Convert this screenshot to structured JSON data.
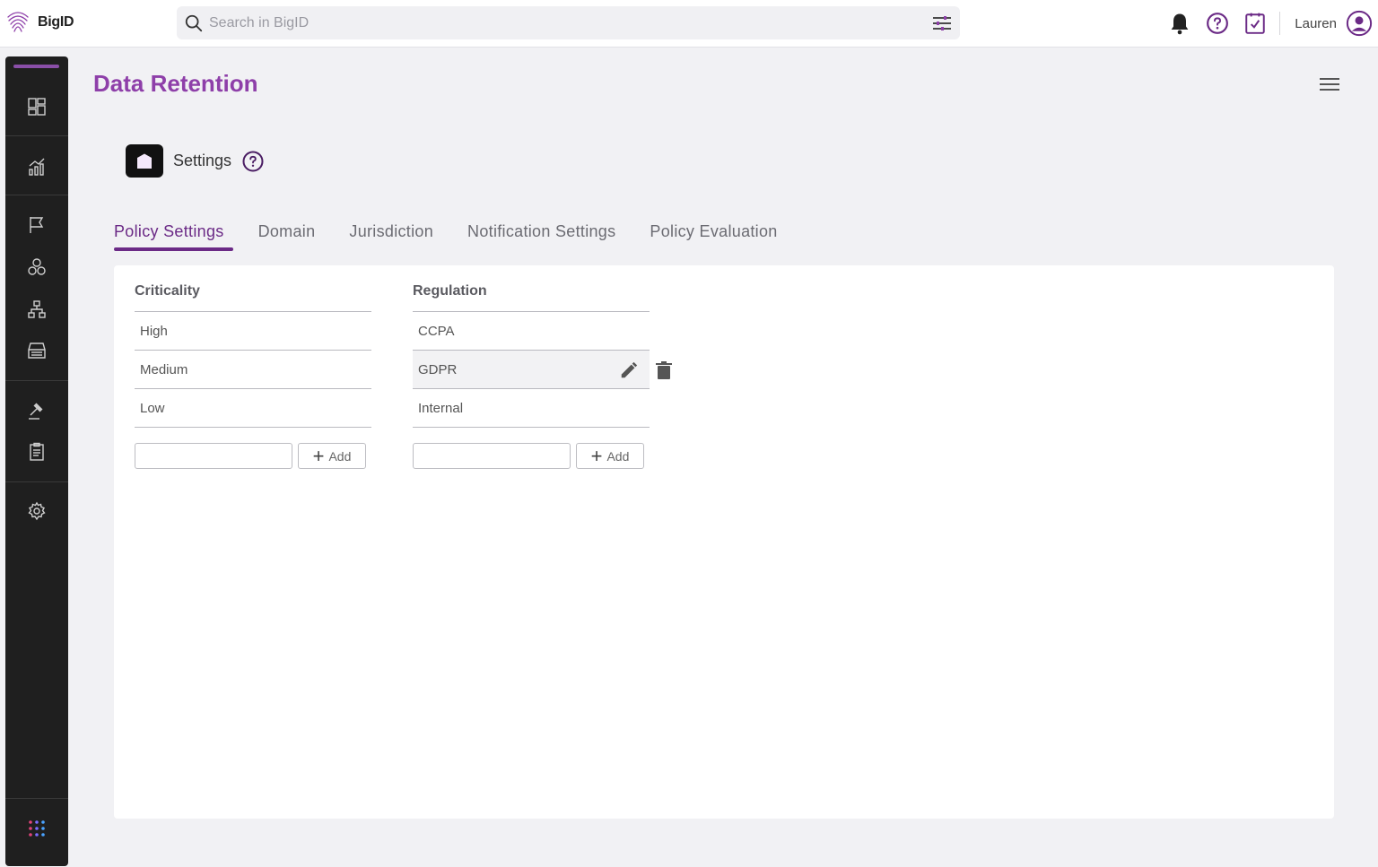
{
  "app": {
    "name": "BigID"
  },
  "search": {
    "placeholder": "Search in BigID"
  },
  "user": {
    "name": "Lauren"
  },
  "page": {
    "title": "Data Retention"
  },
  "settings": {
    "label": "Settings"
  },
  "tabs": [
    {
      "label": "Policy Settings",
      "active": true
    },
    {
      "label": "Domain"
    },
    {
      "label": "Jurisdiction"
    },
    {
      "label": "Notification Settings"
    },
    {
      "label": "Policy Evaluation"
    }
  ],
  "criticality": {
    "header": "Criticality",
    "items": [
      "High",
      "Medium",
      "Low"
    ],
    "add_label": "Add"
  },
  "regulation": {
    "header": "Regulation",
    "items": [
      "CCPA",
      "GDPR",
      "Internal"
    ],
    "add_label": "Add"
  },
  "sidebar": {
    "items": [
      "dashboard-icon",
      "analytics-icon",
      "flag-icon",
      "clusters-icon",
      "hierarchy-icon",
      "inventory-icon",
      "gavel-icon",
      "clipboard-icon",
      "gear-icon",
      "apps-grid-icon"
    ]
  },
  "colors": {
    "accent": "#8e3fa9",
    "tab_active": "#6b2a86",
    "sidebar": "#1f1f1f"
  }
}
